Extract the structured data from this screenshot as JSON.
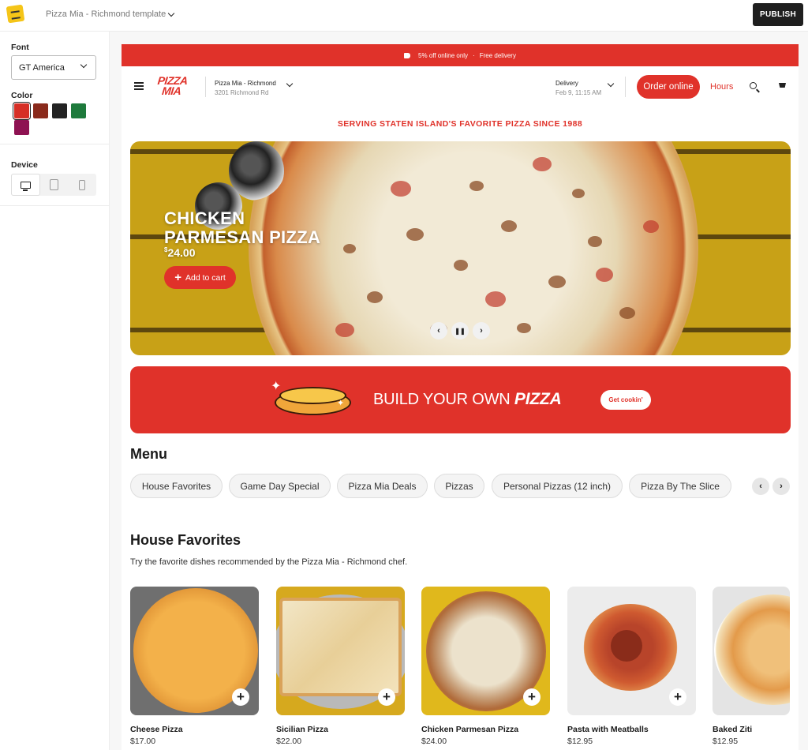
{
  "app": {
    "template_title": "Pizza Mia - Richmond template",
    "publish_label": "PUBLISH"
  },
  "panel": {
    "font_label": "Font",
    "font_value": "GT America",
    "color_label": "Color",
    "colors": [
      "#d62f26",
      "#8a2a1c",
      "#232323",
      "#1e7a3c",
      "#8e1252"
    ],
    "device_label": "Device",
    "devices": [
      "desktop-icon",
      "tablet-icon",
      "phone-icon"
    ]
  },
  "site": {
    "promo": {
      "text": "5% off online only",
      "sep": "·",
      "text2": "Free delivery"
    },
    "header": {
      "brand_line1": "PIZZA",
      "brand_line2": "MIA",
      "store_name": "Pizza Mia - Richmond",
      "store_address": "3201 Richmond Rd",
      "delivery_label": "Delivery",
      "delivery_time": "Feb 9, 11:15 AM",
      "order_label": "Order online",
      "hours_label": "Hours"
    },
    "tagline": "SERVING STATEN ISLAND'S FAVORITE PIZZA SINCE 1988",
    "hero": {
      "title_line1": "CHICKEN",
      "title_line2": "PARMESAN PIZZA",
      "price_symbol": "$",
      "price": "24.00",
      "add_label": "Add to cart",
      "prev": "‹",
      "pause": "❚❚",
      "next": "›"
    },
    "build": {
      "text_plain": "BUILD YOUR OWN ",
      "text_bold": "PIZZA",
      "cta": "Get cookin'"
    },
    "menu": {
      "heading": "Menu",
      "categories": [
        "House Favorites",
        "Game Day Special",
        "Pizza Mia Deals",
        "Pizzas",
        "Personal Pizzas (12 inch)",
        "Pizza By The Slice"
      ],
      "prev": "‹",
      "next": "›"
    },
    "favorites": {
      "heading": "House Favorites",
      "description": "Try the favorite dishes recommended by the Pizza Mia - Richmond chef.",
      "items": [
        {
          "name": "Cheese Pizza",
          "price": "$17.00"
        },
        {
          "name": "Sicilian Pizza",
          "price": "$22.00"
        },
        {
          "name": "Chicken Parmesan Pizza",
          "price": "$24.00"
        },
        {
          "name": "Pasta with Meatballs",
          "price": "$12.95"
        },
        {
          "name": "Baked Ziti",
          "price": "$12.95"
        }
      ]
    }
  }
}
